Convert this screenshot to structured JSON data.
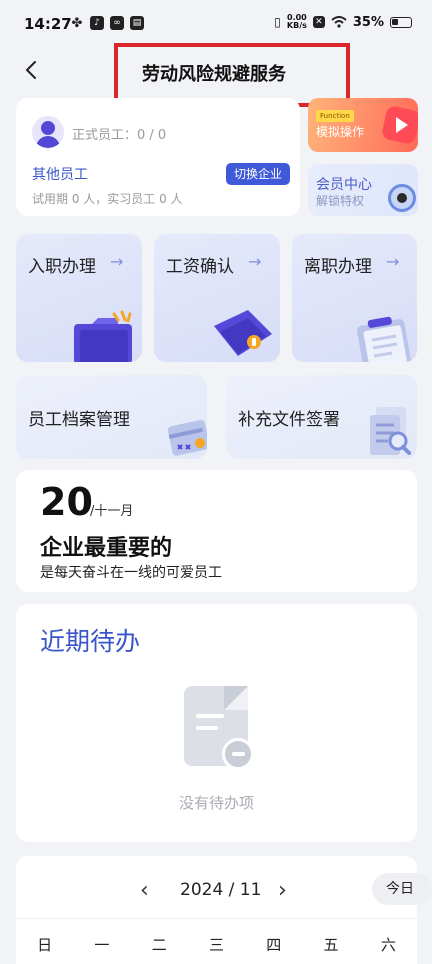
{
  "status_bar": {
    "time": "14:27",
    "net_speed_value": "0.00",
    "net_speed_unit": "KB/s",
    "battery": "35%",
    "icons": [
      "pinwheel-icon",
      "tiktok-icon",
      "link-icon",
      "app-icon",
      "vibrate-icon",
      "sim-icon",
      "wifi-icon",
      "battery-icon"
    ]
  },
  "header": {
    "title": "劳动风险规避服务",
    "back_icon": "back-arrow-icon",
    "highlight_color": "#d9262c"
  },
  "employee_card": {
    "count_label": "正式员工：0 / 0",
    "other_employees": "其他员工",
    "switch_button": "切换企业",
    "trial_info": "试用期 0 人，实习员工 0 人"
  },
  "simulate_card": {
    "tag": "Function",
    "label": "模拟操作"
  },
  "member_card": {
    "title": "会员中心",
    "subtitle": "解锁特权"
  },
  "tiles": [
    {
      "label": "入职办理",
      "arrow": "→"
    },
    {
      "label": "工资确认",
      "arrow": "→"
    },
    {
      "label": "离职办理",
      "arrow": "→"
    },
    {
      "label": "员工档案管理"
    },
    {
      "label": "补充文件签署"
    }
  ],
  "quote": {
    "day": "20",
    "month": "/十一月",
    "title": "企业最重要的",
    "subtitle": "是每天奋斗在一线的可爱员工"
  },
  "todo": {
    "title": "近期待办",
    "empty_text": "没有待办项"
  },
  "calendar": {
    "prev": "‹",
    "month": "2024 / 11",
    "next": "›",
    "today_button": "今日",
    "weekdays": [
      "日",
      "一",
      "二",
      "三",
      "四",
      "五",
      "六"
    ]
  },
  "colors": {
    "accent": "#3f59d8",
    "background": "#f2f3f7",
    "simulate_gradient_end": "#ff6b58"
  }
}
